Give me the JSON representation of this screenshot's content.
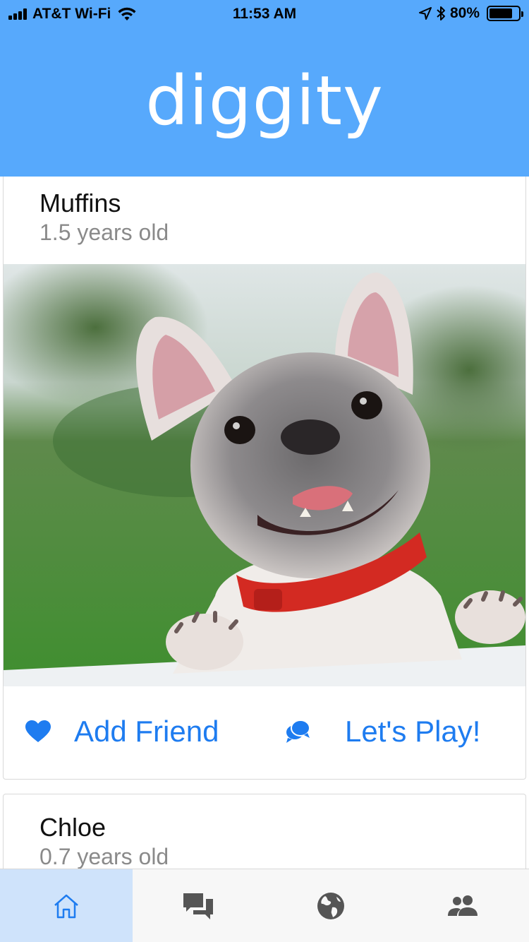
{
  "status_bar": {
    "carrier": "AT&T Wi-Fi",
    "time": "11:53 AM",
    "battery_percent": "80%",
    "battery_level": 0.8,
    "icons": [
      "signal-icon",
      "wifi-icon",
      "location-arrow-icon",
      "bluetooth-icon",
      "battery-icon"
    ]
  },
  "header": {
    "title": "diggity",
    "background_color": "#57a9fc"
  },
  "feed": {
    "cards": [
      {
        "name": "Muffins",
        "age": "1.5 years old",
        "photo": "french-bulldog-photo",
        "actions": {
          "add_friend": "Add Friend",
          "lets_play": "Let's Play!"
        }
      },
      {
        "name": "Chloe",
        "age": "0.7 years old"
      }
    ]
  },
  "tabbar": {
    "tabs": [
      {
        "icon": "home-icon",
        "active": true
      },
      {
        "icon": "chat-icon",
        "active": false
      },
      {
        "icon": "globe-icon",
        "active": false
      },
      {
        "icon": "people-icon",
        "active": false
      }
    ],
    "accent_color": "#1e7cf0"
  }
}
